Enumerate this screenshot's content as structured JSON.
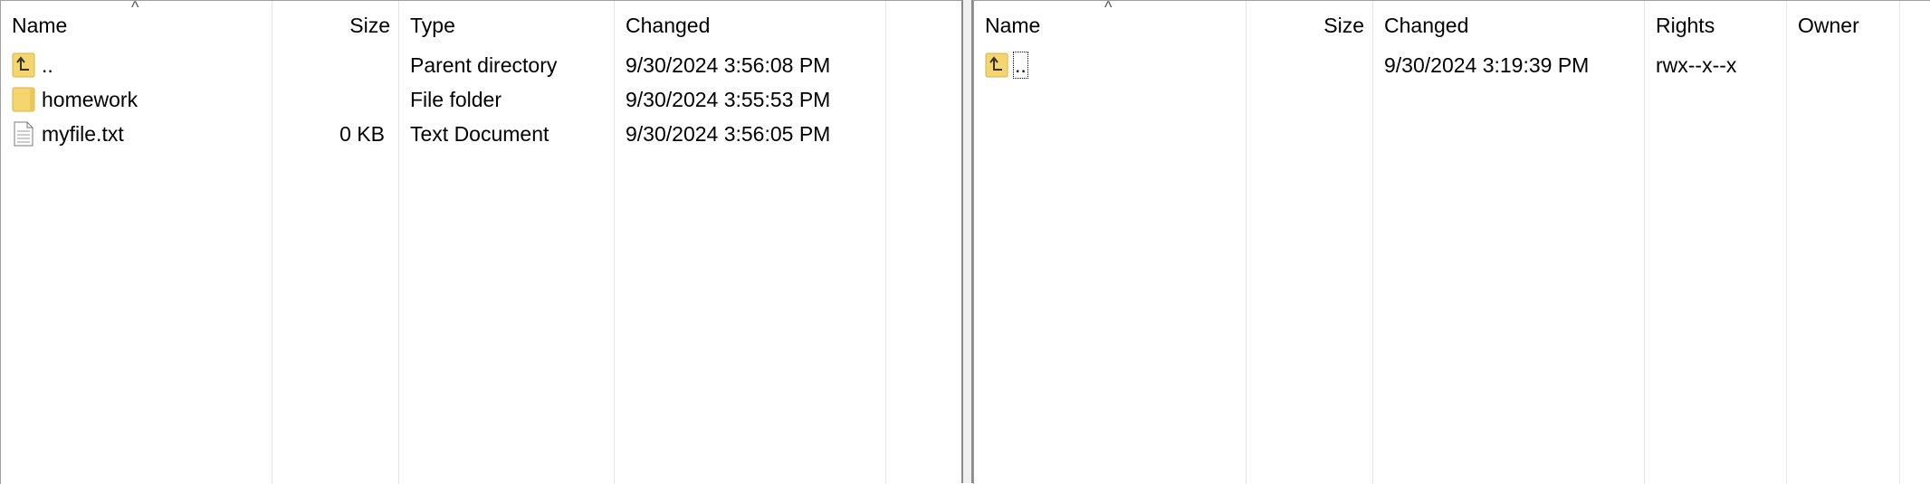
{
  "left_panel": {
    "columns": {
      "name": "Name",
      "size": "Size",
      "type": "Type",
      "changed": "Changed"
    },
    "rows": [
      {
        "name": "..",
        "size": "",
        "type": "Parent directory",
        "changed": "9/30/2024 3:56:08 PM",
        "icon": "parent-folder-icon"
      },
      {
        "name": "homework",
        "size": "",
        "type": "File folder",
        "changed": "9/30/2024 3:55:53 PM",
        "icon": "folder-icon"
      },
      {
        "name": "myfile.txt",
        "size": "0 KB",
        "type": "Text Document",
        "changed": "9/30/2024 3:56:05 PM",
        "icon": "text-file-icon"
      }
    ]
  },
  "right_panel": {
    "columns": {
      "name": "Name",
      "size": "Size",
      "changed": "Changed",
      "rights": "Rights",
      "owner": "Owner"
    },
    "rows": [
      {
        "name": "..",
        "size": "",
        "changed": "9/30/2024 3:19:39 PM",
        "rights": "rwx--x--x",
        "owner": "",
        "icon": "parent-folder-icon"
      }
    ]
  },
  "colors": {
    "folder": "#f5d66e",
    "folder_edge": "#d8b24a",
    "grid_line": "#e5e5e5",
    "splitter": "#f0f0f0"
  }
}
